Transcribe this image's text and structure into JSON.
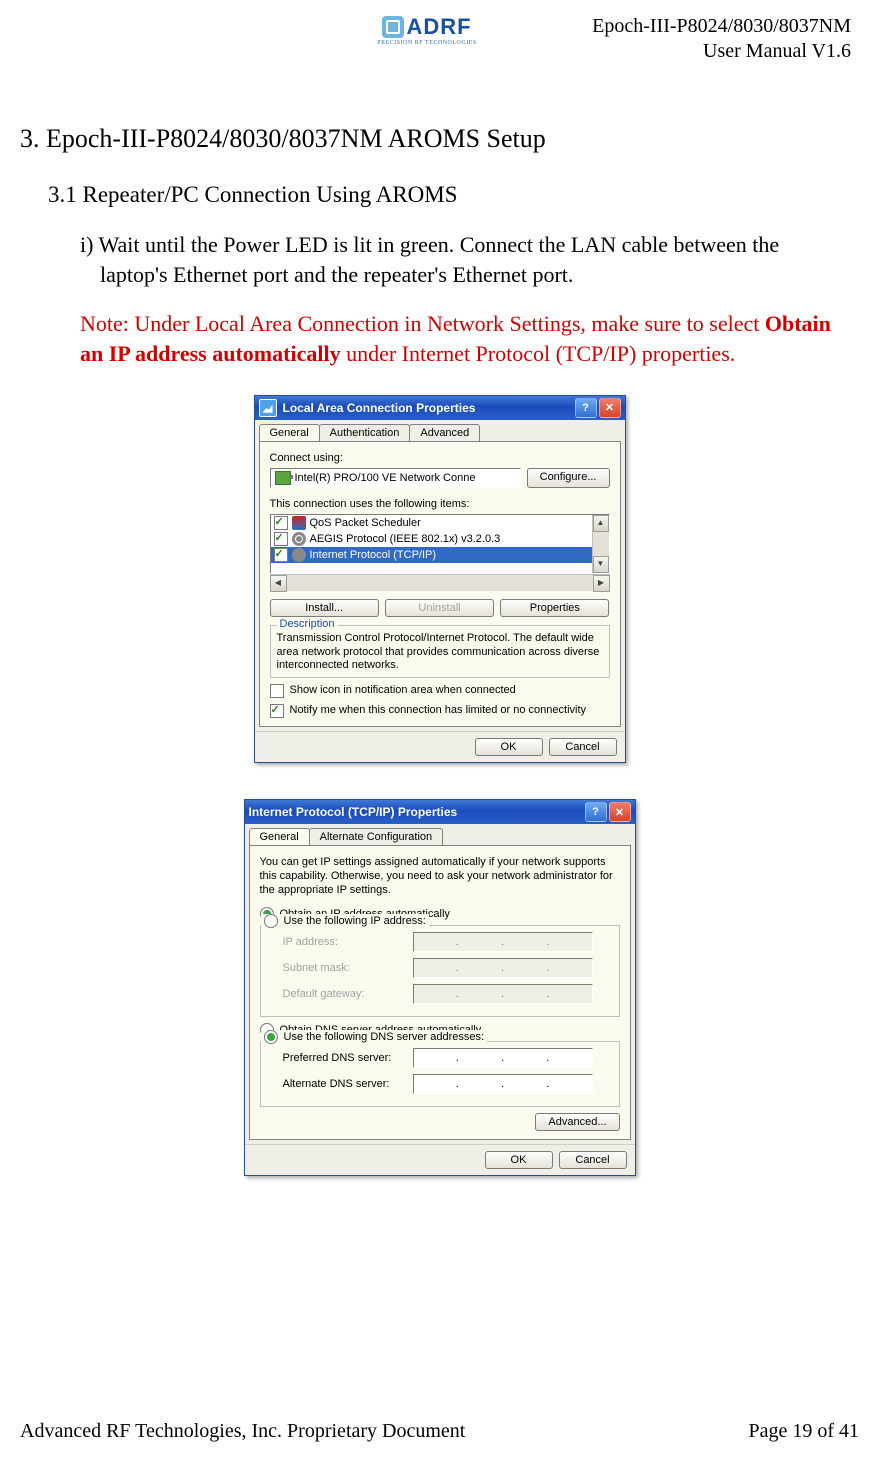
{
  "header": {
    "logo_text": "ADRF",
    "logo_sub": "PRECISION RF TECHNOLOGIES",
    "right_line1": "Epoch-III-P8024/8030/8037NM",
    "right_line2": "User Manual V1.6"
  },
  "section": {
    "h1": "3.  Epoch-III-P8024/8030/8037NM AROMS Setup",
    "h2": "3.1 Repeater/PC Connection Using AROMS",
    "step_i": "i) Wait until the Power LED is lit in green.  Connect the LAN cable between the laptop's Ethernet port and the repeater's Ethernet port.",
    "note_prefix": "Note: Under Local Area Connection in Network Settings, make sure to select ",
    "note_bold": "Obtain an IP address automatically",
    "note_suffix": " under Internet Protocol (TCP/IP) properties."
  },
  "dlg1": {
    "title": "Local Area Connection Properties",
    "tabs": [
      "General",
      "Authentication",
      "Advanced"
    ],
    "connect_using_lbl": "Connect using:",
    "adapter": "Intel(R) PRO/100 VE Network Conne",
    "configure_btn": "Configure...",
    "items_lbl": "This connection uses the following items:",
    "items": [
      {
        "label": "QoS Packet Scheduler",
        "checked": true,
        "icon": "qos"
      },
      {
        "label": "AEGIS Protocol (IEEE 802.1x) v3.2.0.3",
        "checked": true,
        "icon": "aegis"
      },
      {
        "label": "Internet Protocol (TCP/IP)",
        "checked": true,
        "icon": "tcp",
        "selected": true
      }
    ],
    "install_btn": "Install...",
    "uninstall_btn": "Uninstall",
    "properties_btn": "Properties",
    "desc_title": "Description",
    "desc_text": "Transmission Control Protocol/Internet Protocol. The default wide area network protocol that provides communication across diverse interconnected networks.",
    "show_icon_lbl": "Show icon in notification area when connected",
    "notify_lbl": "Notify me when this connection has limited or no connectivity",
    "ok": "OK",
    "cancel": "Cancel"
  },
  "dlg2": {
    "title": "Internet Protocol (TCP/IP) Properties",
    "tabs": [
      "General",
      "Alternate Configuration"
    ],
    "explain": "You can get IP settings assigned automatically if your network supports this capability. Otherwise, you need to ask your network administrator for the appropriate IP settings.",
    "radio_auto_ip": "Obtain an IP address automatically",
    "radio_static_ip": "Use the following IP address:",
    "ip_labels": [
      "IP address:",
      "Subnet mask:",
      "Default gateway:"
    ],
    "radio_auto_dns": "Obtain DNS server address automatically",
    "radio_static_dns": "Use the following DNS server addresses:",
    "dns_labels": [
      "Preferred DNS server:",
      "Alternate DNS server:"
    ],
    "advanced_btn": "Advanced...",
    "ok": "OK",
    "cancel": "Cancel"
  },
  "footer": {
    "left": "Advanced RF Technologies, Inc. Proprietary Document",
    "right": "Page 19 of 41"
  }
}
